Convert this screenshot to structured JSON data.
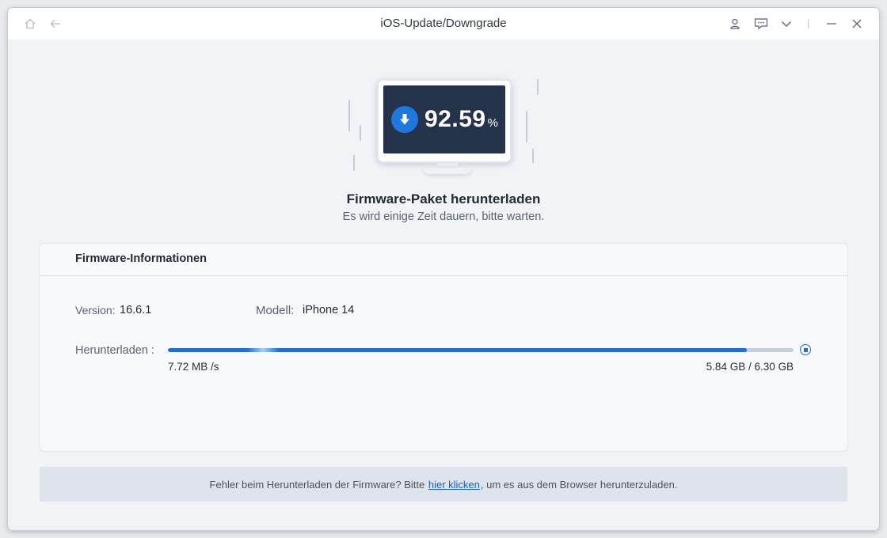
{
  "window": {
    "title": "iOS-Update/Downgrade",
    "icons": [
      "home-icon",
      "back-arrow-icon",
      "user-icon",
      "feedback-icon",
      "chevron-down-icon",
      "minimize-icon",
      "close-icon"
    ]
  },
  "download": {
    "percent": "92.59",
    "percent_sign": "%",
    "progress_fraction": 0.9259,
    "heading": "Firmware-Paket herunterladen",
    "subheading": "Es wird einige Zeit dauern, bitte warten."
  },
  "firmware_info": {
    "title": "Firmware-Informationen",
    "version_label": "Version:",
    "version_value": "16.6.1",
    "model_label": "Modell:",
    "model_value": "iPhone 14",
    "download_label": "Herunterladen :",
    "speed": "7.72 MB /s",
    "size": "5.84 GB / 6.30 GB"
  },
  "notice": {
    "prefix": "Fehler beim Herunterladen der Firmware? Bitte",
    "link": "hier klicken",
    "suffix": ", um es aus dem Browser herunterzuladen."
  },
  "colors": {
    "accent": "#1f6fd6",
    "screen": "#24324a",
    "track": "#c9d0da"
  }
}
